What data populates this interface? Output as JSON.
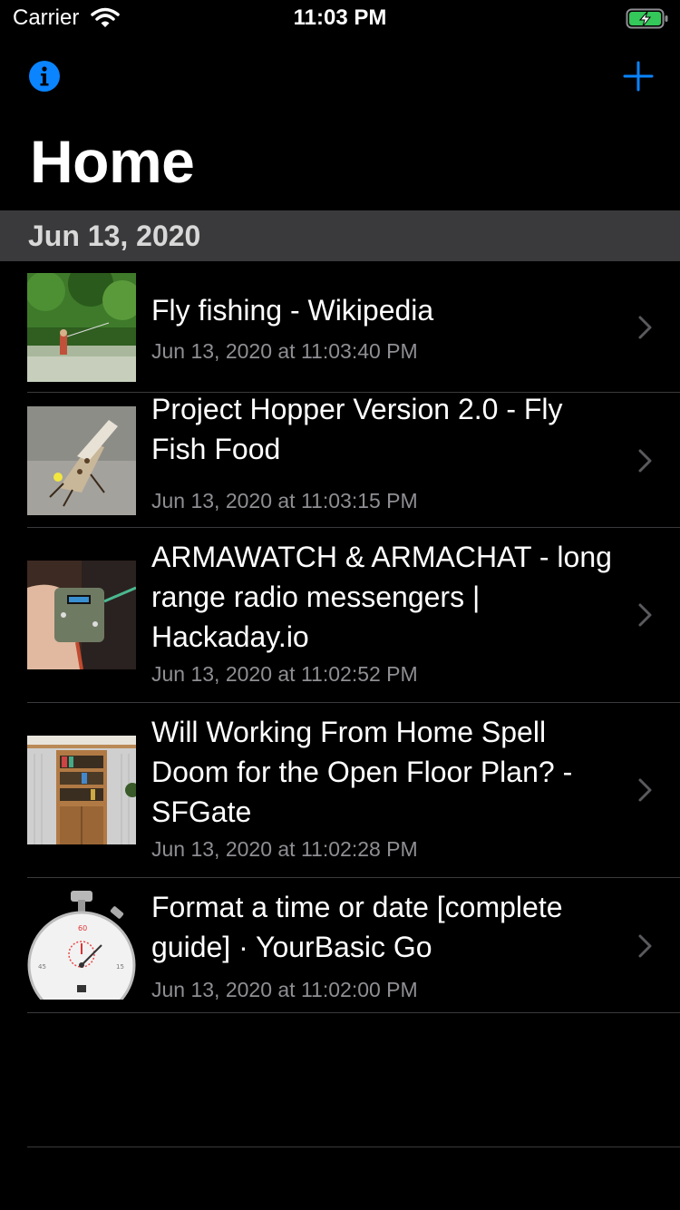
{
  "status_bar": {
    "carrier": "Carrier",
    "time": "11:03 PM",
    "wifi_icon": "wifi-icon",
    "battery_icon": "battery-charging-icon"
  },
  "nav": {
    "info_icon": "info-icon",
    "add_icon": "plus-icon",
    "accent_color": "#0a84ff"
  },
  "page": {
    "title": "Home"
  },
  "section": {
    "header": "Jun 13, 2020"
  },
  "items": [
    {
      "title": "Fly fishing - Wikipedia",
      "date": "Jun 13, 2020 at 11:03:40 PM",
      "thumb": "river-fishing-photo"
    },
    {
      "title": "Project Hopper Version 2.0 - Fly Fish Food",
      "date": "Jun 13, 2020 at 11:03:15 PM",
      "thumb": "fly-lure-photo"
    },
    {
      "title": "ARMAWATCH & ARMACHAT - long range radio messengers | Hackaday.io",
      "date": "Jun 13, 2020 at 11:02:52 PM",
      "thumb": "radio-device-photo"
    },
    {
      "title": "Will Working From Home Spell Doom for the Open Floor Plan? - SFGate",
      "date": "Jun 13, 2020 at 11:02:28 PM",
      "thumb": "bookshelf-illustration"
    },
    {
      "title": "Format a time or date [complete guide] · YourBasic Go",
      "date": "Jun 13, 2020 at 11:02:00 PM",
      "thumb": "stopwatch-image"
    }
  ]
}
